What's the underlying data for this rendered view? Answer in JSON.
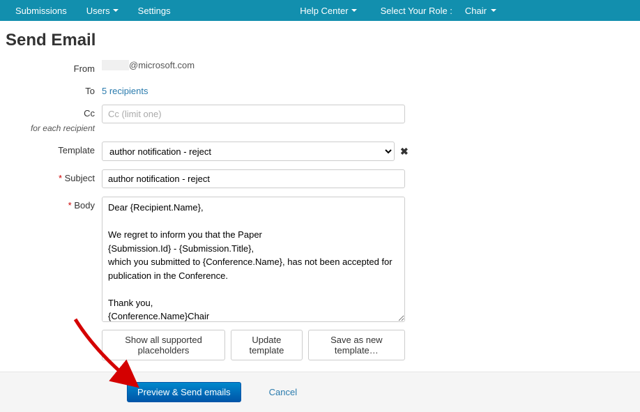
{
  "nav": {
    "submissions": "Submissions",
    "users": "Users",
    "settings": "Settings",
    "help_center": "Help Center",
    "role_label": "Select Your Role :",
    "role_value": "Chair"
  },
  "page_title": "Send Email",
  "labels": {
    "from": "From",
    "to": "To",
    "cc": "Cc",
    "cc_sub": "for each recipient",
    "template": "Template",
    "subject": "Subject",
    "body": "Body"
  },
  "fields": {
    "from_value": "@microsoft.com",
    "to_text": "5 recipients",
    "cc_placeholder": "Cc (limit one)",
    "template_value": "author notification - reject",
    "subject_value": "author notification - reject",
    "body_value": "Dear {Recipient.Name},\n\nWe regret to inform you that the Paper\n{Submission.Id} - {Submission.Title},\nwhich you submitted to {Conference.Name}, has not been accepted for publication in the Conference.\n\nThank you,\n{Conference.Name}Chair"
  },
  "buttons": {
    "show_placeholders": "Show all supported placeholders",
    "update_template": "Update template",
    "save_new_template": "Save as new template…",
    "preview_send": "Preview & Send emails",
    "cancel": "Cancel"
  }
}
